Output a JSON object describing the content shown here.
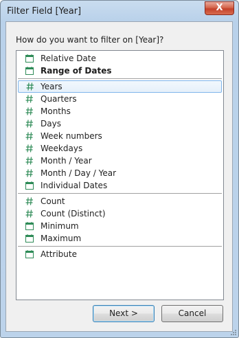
{
  "window": {
    "title": "Filter Field [Year]",
    "close_label": "X"
  },
  "dialog": {
    "prompt": "How do you want to filter on [Year]?"
  },
  "options": [
    {
      "label": "Relative Date",
      "icon": "calendar-icon",
      "bold": false,
      "selected": false
    },
    {
      "label": "Range of Dates",
      "icon": "calendar-icon",
      "bold": true,
      "selected": false
    },
    {
      "label": "Years",
      "icon": "hash-icon",
      "bold": false,
      "selected": true
    },
    {
      "label": "Quarters",
      "icon": "hash-icon",
      "bold": false,
      "selected": false
    },
    {
      "label": "Months",
      "icon": "hash-icon",
      "bold": false,
      "selected": false
    },
    {
      "label": "Days",
      "icon": "hash-icon",
      "bold": false,
      "selected": false
    },
    {
      "label": "Week numbers",
      "icon": "hash-icon",
      "bold": false,
      "selected": false
    },
    {
      "label": "Weekdays",
      "icon": "hash-icon",
      "bold": false,
      "selected": false
    },
    {
      "label": "Month / Year",
      "icon": "hash-icon",
      "bold": false,
      "selected": false
    },
    {
      "label": "Month / Day / Year",
      "icon": "hash-icon",
      "bold": false,
      "selected": false
    },
    {
      "label": "Individual Dates",
      "icon": "calendar-icon",
      "bold": false,
      "selected": false
    },
    {
      "label": "Count",
      "icon": "hash-icon",
      "bold": false,
      "selected": false
    },
    {
      "label": "Count (Distinct)",
      "icon": "hash-icon",
      "bold": false,
      "selected": false
    },
    {
      "label": "Minimum",
      "icon": "calendar-icon",
      "bold": false,
      "selected": false
    },
    {
      "label": "Maximum",
      "icon": "calendar-icon",
      "bold": false,
      "selected": false
    },
    {
      "label": "Attribute",
      "icon": "calendar-icon",
      "bold": false,
      "selected": false
    }
  ],
  "buttons": {
    "next": "Next >",
    "cancel": "Cancel"
  },
  "colors": {
    "icon_green": "#2e8b57",
    "selection_border": "#7eb4ea",
    "default_button_border": "#3c7fb1",
    "close_red": "#c4412a"
  }
}
